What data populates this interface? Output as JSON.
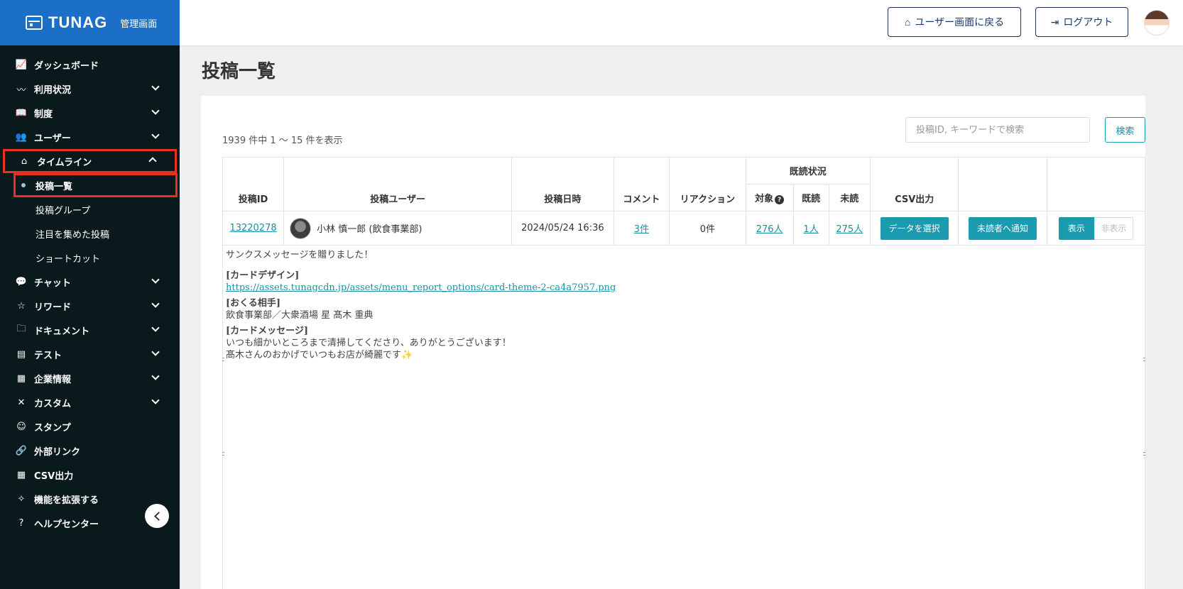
{
  "brand": {
    "name": "TUNAG",
    "sub": "管理画面"
  },
  "sidebar": {
    "items": [
      {
        "label": "ダッシュボード",
        "icon": "chart-icon",
        "glyph": "📈",
        "chevron": ""
      },
      {
        "label": "利用状況",
        "icon": "activity-icon",
        "glyph": "〰",
        "chevron": "down"
      },
      {
        "label": "制度",
        "icon": "book-icon",
        "glyph": "📖",
        "chevron": "down"
      },
      {
        "label": "ユーザー",
        "icon": "users-icon",
        "glyph": "👥",
        "chevron": "down"
      },
      {
        "label": "タイムライン",
        "icon": "home-icon",
        "glyph": "⌂",
        "chevron": "up"
      },
      {
        "label": "チャット",
        "icon": "chat-icon",
        "glyph": "💬",
        "chevron": "down"
      },
      {
        "label": "リワード",
        "icon": "star-icon",
        "glyph": "☆",
        "chevron": "down"
      },
      {
        "label": "ドキュメント",
        "icon": "folder-icon",
        "glyph": "🗀",
        "chevron": "down"
      },
      {
        "label": "テスト",
        "icon": "test-icon",
        "glyph": "▤",
        "chevron": "down"
      },
      {
        "label": "企業情報",
        "icon": "building-icon",
        "glyph": "▦",
        "chevron": "down"
      },
      {
        "label": "カスタム",
        "icon": "tools-icon",
        "glyph": "✕",
        "chevron": "down"
      },
      {
        "label": "スタンプ",
        "icon": "smile-icon",
        "glyph": "☺",
        "chevron": ""
      },
      {
        "label": "外部リンク",
        "icon": "link-icon",
        "glyph": "🔗",
        "chevron": ""
      },
      {
        "label": "CSV出力",
        "icon": "table-icon",
        "glyph": "▦",
        "chevron": ""
      },
      {
        "label": "機能を拡張する",
        "icon": "sparkle-icon",
        "glyph": "✧",
        "chevron": ""
      },
      {
        "label": "ヘルプセンター",
        "icon": "help-icon",
        "glyph": "?",
        "chevron": ""
      }
    ],
    "timeline_sub": [
      {
        "label": "投稿一覧",
        "active": true
      },
      {
        "label": "投稿グループ"
      },
      {
        "label": "注目を集めた投稿"
      },
      {
        "label": "ショートカット"
      }
    ]
  },
  "header": {
    "user_screen_label": "ユーザー画面に戻る",
    "logout_label": "ログアウト"
  },
  "main": {
    "title": "投稿一覧",
    "count_text": "1939 件中 1 〜 15 件を表示",
    "search_placeholder": "投稿ID, キーワードで検索",
    "search_button": "検索",
    "columns": {
      "post_id": "投稿ID",
      "user": "投稿ユーザー",
      "date": "投稿日時",
      "comment": "コメント",
      "reaction": "リアクション",
      "read_status": "既読状況",
      "target": "対象",
      "read": "既読",
      "unread": "未読",
      "csv": "CSV出力"
    },
    "row": {
      "post_id": "13220278",
      "user": "小林 慎一郎 (飲食事業部)",
      "date": "2024/05/24 16:36",
      "comment": "3件",
      "reaction": "0件",
      "target": "276人",
      "read": "1人",
      "unread": "275人",
      "csv_button": "データを選択",
      "notify_button": "未読者へ通知",
      "show_button": "表示",
      "hide_button": "非表示"
    },
    "content": {
      "line1": "サンクスメッセージを贈りました！",
      "h1": "[カードデザイン]",
      "url": "https://assets.tunagcdn.jp/assets/menu_report_options/card-theme-2-ca4a7957.png",
      "h2": "[おくる相手]",
      "recipient": "飲食事業部／大衆酒場 星 髙木 重典",
      "h3": "[カードメッセージ]",
      "msg1": "いつも細かいところまで清掃してくださり、ありがとうございます！",
      "msg2": "髙木さんのおかげでいつもお店が綺麗です✨"
    }
  }
}
